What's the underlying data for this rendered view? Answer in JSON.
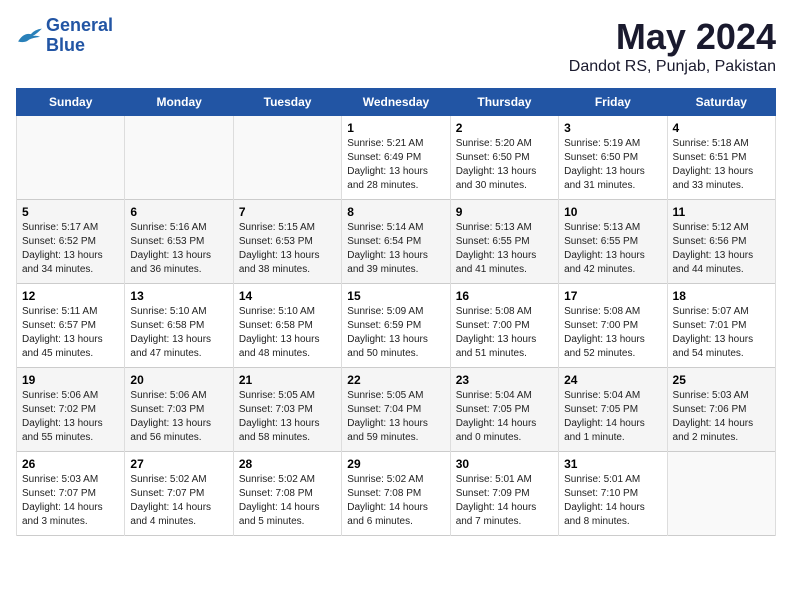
{
  "logo": {
    "line1": "General",
    "line2": "Blue"
  },
  "title": "May 2024",
  "subtitle": "Dandot RS, Punjab, Pakistan",
  "weekdays": [
    "Sunday",
    "Monday",
    "Tuesday",
    "Wednesday",
    "Thursday",
    "Friday",
    "Saturday"
  ],
  "weeks": [
    [
      {
        "day": "",
        "info": ""
      },
      {
        "day": "",
        "info": ""
      },
      {
        "day": "",
        "info": ""
      },
      {
        "day": "1",
        "info": "Sunrise: 5:21 AM\nSunset: 6:49 PM\nDaylight: 13 hours and 28 minutes."
      },
      {
        "day": "2",
        "info": "Sunrise: 5:20 AM\nSunset: 6:50 PM\nDaylight: 13 hours and 30 minutes."
      },
      {
        "day": "3",
        "info": "Sunrise: 5:19 AM\nSunset: 6:50 PM\nDaylight: 13 hours and 31 minutes."
      },
      {
        "day": "4",
        "info": "Sunrise: 5:18 AM\nSunset: 6:51 PM\nDaylight: 13 hours and 33 minutes."
      }
    ],
    [
      {
        "day": "5",
        "info": "Sunrise: 5:17 AM\nSunset: 6:52 PM\nDaylight: 13 hours and 34 minutes."
      },
      {
        "day": "6",
        "info": "Sunrise: 5:16 AM\nSunset: 6:53 PM\nDaylight: 13 hours and 36 minutes."
      },
      {
        "day": "7",
        "info": "Sunrise: 5:15 AM\nSunset: 6:53 PM\nDaylight: 13 hours and 38 minutes."
      },
      {
        "day": "8",
        "info": "Sunrise: 5:14 AM\nSunset: 6:54 PM\nDaylight: 13 hours and 39 minutes."
      },
      {
        "day": "9",
        "info": "Sunrise: 5:13 AM\nSunset: 6:55 PM\nDaylight: 13 hours and 41 minutes."
      },
      {
        "day": "10",
        "info": "Sunrise: 5:13 AM\nSunset: 6:55 PM\nDaylight: 13 hours and 42 minutes."
      },
      {
        "day": "11",
        "info": "Sunrise: 5:12 AM\nSunset: 6:56 PM\nDaylight: 13 hours and 44 minutes."
      }
    ],
    [
      {
        "day": "12",
        "info": "Sunrise: 5:11 AM\nSunset: 6:57 PM\nDaylight: 13 hours and 45 minutes."
      },
      {
        "day": "13",
        "info": "Sunrise: 5:10 AM\nSunset: 6:58 PM\nDaylight: 13 hours and 47 minutes."
      },
      {
        "day": "14",
        "info": "Sunrise: 5:10 AM\nSunset: 6:58 PM\nDaylight: 13 hours and 48 minutes."
      },
      {
        "day": "15",
        "info": "Sunrise: 5:09 AM\nSunset: 6:59 PM\nDaylight: 13 hours and 50 minutes."
      },
      {
        "day": "16",
        "info": "Sunrise: 5:08 AM\nSunset: 7:00 PM\nDaylight: 13 hours and 51 minutes."
      },
      {
        "day": "17",
        "info": "Sunrise: 5:08 AM\nSunset: 7:00 PM\nDaylight: 13 hours and 52 minutes."
      },
      {
        "day": "18",
        "info": "Sunrise: 5:07 AM\nSunset: 7:01 PM\nDaylight: 13 hours and 54 minutes."
      }
    ],
    [
      {
        "day": "19",
        "info": "Sunrise: 5:06 AM\nSunset: 7:02 PM\nDaylight: 13 hours and 55 minutes."
      },
      {
        "day": "20",
        "info": "Sunrise: 5:06 AM\nSunset: 7:03 PM\nDaylight: 13 hours and 56 minutes."
      },
      {
        "day": "21",
        "info": "Sunrise: 5:05 AM\nSunset: 7:03 PM\nDaylight: 13 hours and 58 minutes."
      },
      {
        "day": "22",
        "info": "Sunrise: 5:05 AM\nSunset: 7:04 PM\nDaylight: 13 hours and 59 minutes."
      },
      {
        "day": "23",
        "info": "Sunrise: 5:04 AM\nSunset: 7:05 PM\nDaylight: 14 hours and 0 minutes."
      },
      {
        "day": "24",
        "info": "Sunrise: 5:04 AM\nSunset: 7:05 PM\nDaylight: 14 hours and 1 minute."
      },
      {
        "day": "25",
        "info": "Sunrise: 5:03 AM\nSunset: 7:06 PM\nDaylight: 14 hours and 2 minutes."
      }
    ],
    [
      {
        "day": "26",
        "info": "Sunrise: 5:03 AM\nSunset: 7:07 PM\nDaylight: 14 hours and 3 minutes."
      },
      {
        "day": "27",
        "info": "Sunrise: 5:02 AM\nSunset: 7:07 PM\nDaylight: 14 hours and 4 minutes."
      },
      {
        "day": "28",
        "info": "Sunrise: 5:02 AM\nSunset: 7:08 PM\nDaylight: 14 hours and 5 minutes."
      },
      {
        "day": "29",
        "info": "Sunrise: 5:02 AM\nSunset: 7:08 PM\nDaylight: 14 hours and 6 minutes."
      },
      {
        "day": "30",
        "info": "Sunrise: 5:01 AM\nSunset: 7:09 PM\nDaylight: 14 hours and 7 minutes."
      },
      {
        "day": "31",
        "info": "Sunrise: 5:01 AM\nSunset: 7:10 PM\nDaylight: 14 hours and 8 minutes."
      },
      {
        "day": "",
        "info": ""
      }
    ]
  ]
}
